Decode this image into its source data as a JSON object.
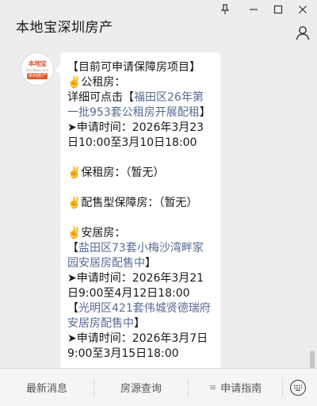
{
  "window": {
    "title": "本地宝深圳房产",
    "pin_icon": "pin-icon",
    "minimize_icon": "minimize-icon",
    "maximize_icon": "maximize-icon",
    "close_icon": "close-icon",
    "profile_icon": "user-icon"
  },
  "avatar": {
    "brand": "本地宝",
    "domain": "bendibao.com",
    "badge": "深圳房产"
  },
  "message": {
    "heading": "【目前可申请保障房项目】",
    "public_rent": {
      "title": "✌️公租房：",
      "detail_prefix": "详细可点击【",
      "link": "福田区26年第一批953套公租房开展配租",
      "detail_suffix": "】",
      "apply_time": "➤申请时间：2026年3月23日10:00至3月10日18:00"
    },
    "guarantee_rent": "✌️保租房：（暂无）",
    "allocation": "✌️配售型保障房：（暂无）",
    "anju": {
      "title": "✌️安居房：",
      "item1_open": "【",
      "item1_link": "盐田区73套小梅沙湾畔家园安居房配售中",
      "item1_close": "】",
      "item1_time": "➤申请时间：2026年3月21日9:00至4月12日18:00",
      "item2_open": "【",
      "item2_link": "光明区421套伟城贤德瑞府安居房配售中",
      "item2_close": "】",
      "item2_time": "➤申请时间：2026年3月7日9:00至3月15日18:00"
    }
  },
  "menu": {
    "item1": "最新消息",
    "item2": "房源查询",
    "item3_icon": "≡",
    "item3": "申请指南",
    "keyboard_icon": "keyboard-icon"
  }
}
